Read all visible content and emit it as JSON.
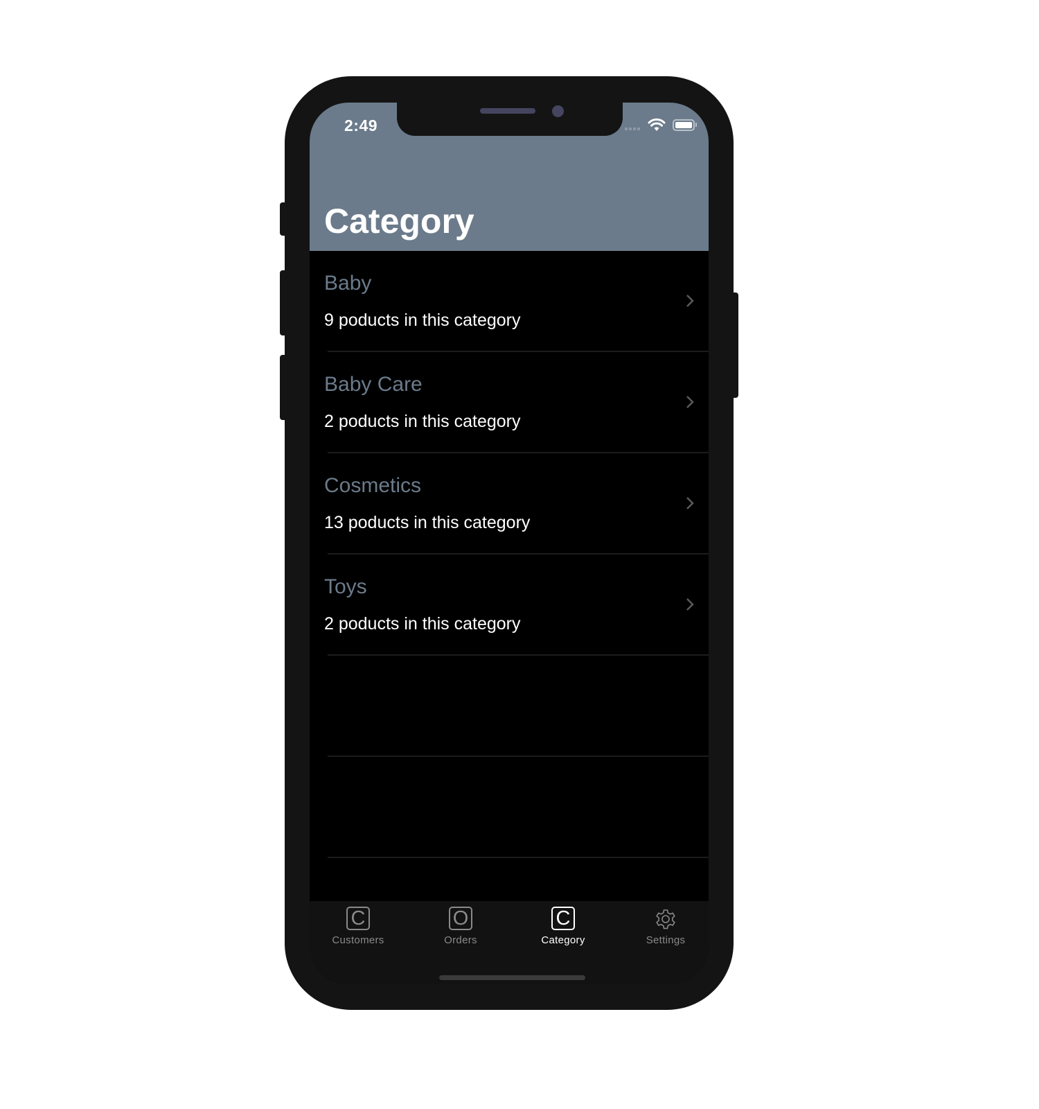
{
  "status_bar": {
    "time": "2:49",
    "icons": [
      "signal-dots-icon",
      "wifi-icon",
      "battery-icon"
    ]
  },
  "header": {
    "title": "Category",
    "background_color": "#6b7b8b"
  },
  "categories": [
    {
      "name": "Baby",
      "subtitle": "9 poducts in this category"
    },
    {
      "name": "Baby Care",
      "subtitle": "2 poducts in this category"
    },
    {
      "name": "Cosmetics",
      "subtitle": "13 poducts in this category"
    },
    {
      "name": "Toys",
      "subtitle": "2 poducts in this category"
    }
  ],
  "tabbar": {
    "tabs": [
      {
        "label": "Customers",
        "icon_glyph": "C",
        "icon": "customers-icon",
        "active": false
      },
      {
        "label": "Orders",
        "icon_glyph": "O",
        "icon": "orders-icon",
        "active": false
      },
      {
        "label": "Category",
        "icon_glyph": "C",
        "icon": "category-icon",
        "active": true
      },
      {
        "label": "Settings",
        "icon": "gear-icon",
        "active": false
      }
    ]
  },
  "colors": {
    "accent": "#6b7b8b",
    "background": "#000000",
    "tab_inactive": "#8a8a8a",
    "tab_active": "#ffffff"
  }
}
